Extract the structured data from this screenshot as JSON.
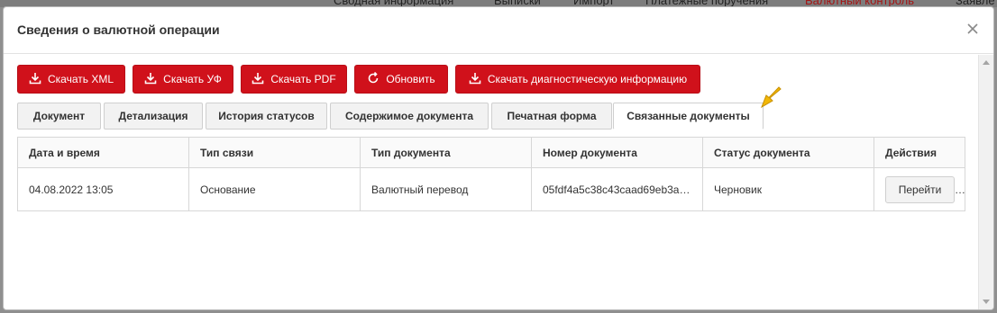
{
  "background_nav": [
    "Сводная информация",
    "Выписки",
    "Импорт",
    "Платежные поручения",
    "Валютный контроль",
    "Заявле"
  ],
  "modal": {
    "title": "Сведения о валютной операции"
  },
  "toolbar": {
    "buttons": [
      {
        "label": "Скачать XML",
        "icon": "download-icon"
      },
      {
        "label": "Скачать УФ",
        "icon": "download-icon"
      },
      {
        "label": "Скачать PDF",
        "icon": "download-icon"
      },
      {
        "label": "Обновить",
        "icon": "refresh-icon"
      },
      {
        "label": "Скачать диагностическую информацию",
        "icon": "download-icon"
      }
    ]
  },
  "tabs": [
    {
      "label": "Документ",
      "active": false
    },
    {
      "label": "Детализация",
      "active": false
    },
    {
      "label": "История статусов",
      "active": false
    },
    {
      "label": "Содержимое документа",
      "active": false
    },
    {
      "label": "Печатная форма",
      "active": false
    },
    {
      "label": "Связанные документы",
      "active": true
    }
  ],
  "table": {
    "columns": [
      "Дата и время",
      "Тип связи",
      "Тип документа",
      "Номер документа",
      "Статус документа",
      "Действия"
    ],
    "rows": [
      {
        "datetime": "04.08.2022 13:05",
        "link_type": "Основание",
        "doc_type": "Валютный перевод",
        "doc_number": "05fdf4a5c38c43caad69eb3a4…",
        "status": "Черновик",
        "action_label": "Перейти"
      }
    ]
  },
  "colors": {
    "accent": "#d0111b",
    "pointer": "#f2b705",
    "overlay": "#8f8f8f"
  }
}
